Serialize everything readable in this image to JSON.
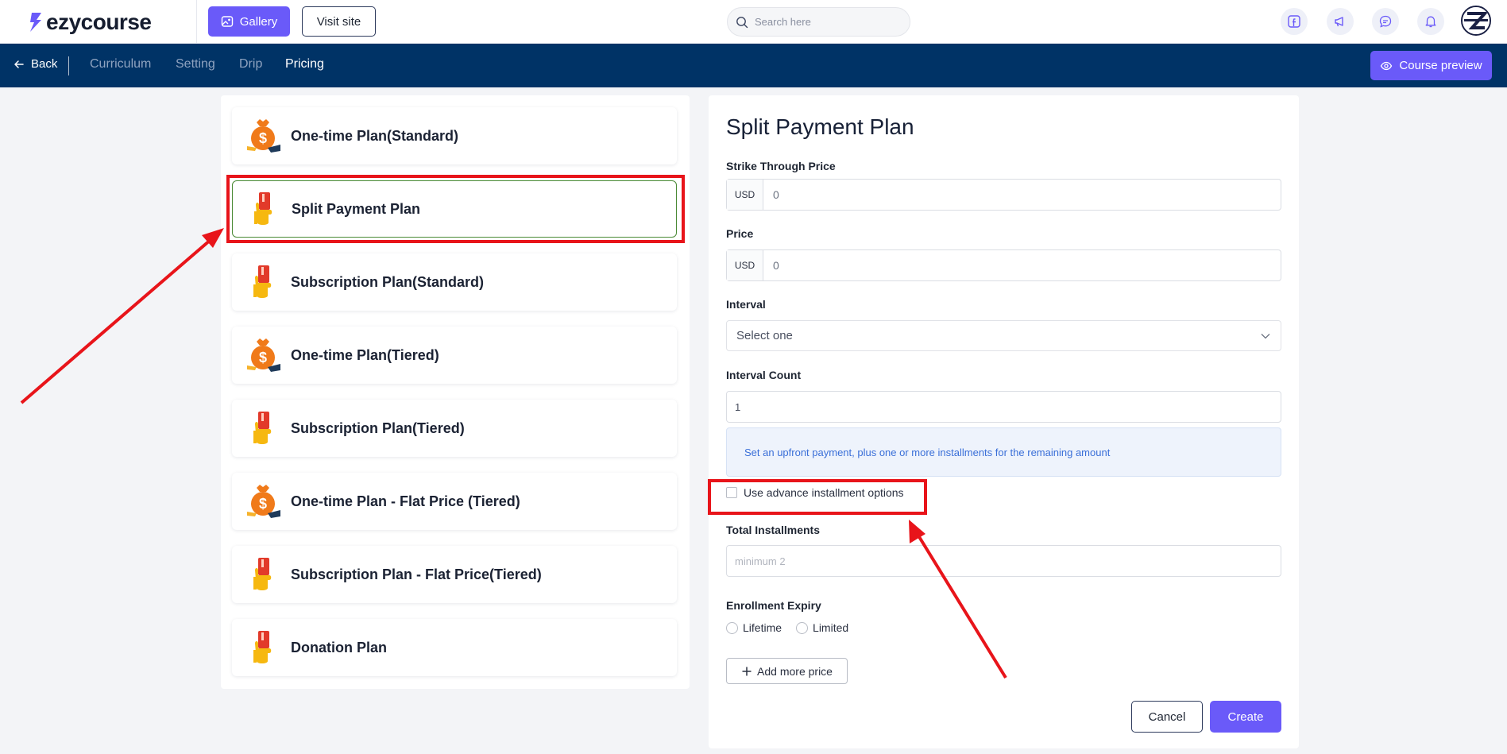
{
  "app": {
    "logo_text": "ezycourse"
  },
  "header": {
    "gallery_label": "Gallery",
    "visit_site_label": "Visit site",
    "search_placeholder": "Search here"
  },
  "nav": {
    "back_label": "Back",
    "tabs": [
      {
        "label": "Curriculum",
        "active": false
      },
      {
        "label": "Setting",
        "active": false
      },
      {
        "label": "Drip",
        "active": false
      },
      {
        "label": "Pricing",
        "active": true
      }
    ],
    "preview_label": "Course preview"
  },
  "plans": [
    {
      "label": "One-time Plan(Standard)",
      "icon": "money-bag-icon",
      "selected": false
    },
    {
      "label": "Split Payment Plan",
      "icon": "card-hand-icon",
      "selected": true
    },
    {
      "label": "Subscription Plan(Standard)",
      "icon": "card-hand-icon",
      "selected": false
    },
    {
      "label": "One-time Plan(Tiered)",
      "icon": "money-bag-icon",
      "selected": false
    },
    {
      "label": "Subscription Plan(Tiered)",
      "icon": "card-hand-icon",
      "selected": false
    },
    {
      "label": "One-time Plan - Flat Price (Tiered)",
      "icon": "money-bag-icon",
      "selected": false
    },
    {
      "label": "Subscription Plan - Flat Price(Tiered)",
      "icon": "card-hand-icon",
      "selected": false
    },
    {
      "label": "Donation Plan",
      "icon": "card-hand-icon",
      "selected": false
    }
  ],
  "form": {
    "title": "Split Payment Plan",
    "strike_price": {
      "label": "Strike Through Price",
      "currency": "USD",
      "value": "0"
    },
    "price": {
      "label": "Price",
      "currency": "USD",
      "value": "0"
    },
    "interval": {
      "label": "Interval",
      "selected": "Select one"
    },
    "interval_count": {
      "label": "Interval Count",
      "value": "1"
    },
    "info_text": "Set an upfront payment, plus one or more installments for the remaining amount",
    "advance_option_label": "Use advance installment options",
    "total_installments": {
      "label": "Total Installments",
      "placeholder": "minimum 2"
    },
    "expiry": {
      "label": "Enrollment Expiry",
      "options": [
        "Lifetime",
        "Limited"
      ]
    },
    "add_price_label": "Add more price",
    "cancel_label": "Cancel",
    "create_label": "Create"
  },
  "colors": {
    "accent": "#6a5af9",
    "nav_bg": "#003366",
    "highlight": "#e8141a",
    "selected_border": "#4a8a35"
  }
}
